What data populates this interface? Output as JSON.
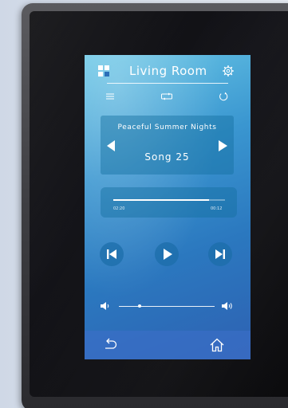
{
  "header": {
    "room_name": "Living Room"
  },
  "now_playing": {
    "playlist": "Peaceful Summer Nights",
    "song": "Song 25"
  },
  "progress": {
    "elapsed": "02:20",
    "remaining": "00:12",
    "fraction": 0.86
  },
  "volume": {
    "level": 0.22
  },
  "icons": {
    "logo": "app-logo-icon",
    "settings": "gear-icon",
    "menu": "hamburger-menu-icon",
    "repeat": "repeat-icon",
    "refresh": "refresh-icon",
    "previous_playlist": "triangle-left-icon",
    "next_playlist": "triangle-right-icon",
    "previous_track": "skip-previous-icon",
    "play": "play-icon",
    "next_track": "skip-next-icon",
    "volume_low": "volume-low-icon",
    "volume_high": "volume-high-icon",
    "back": "back-arrow-icon",
    "home": "home-icon"
  },
  "colors": {
    "screen_top": "#69c7e6",
    "screen_bottom": "#2e61b2",
    "footer": "#3c6ec8",
    "text": "#ffffff"
  }
}
